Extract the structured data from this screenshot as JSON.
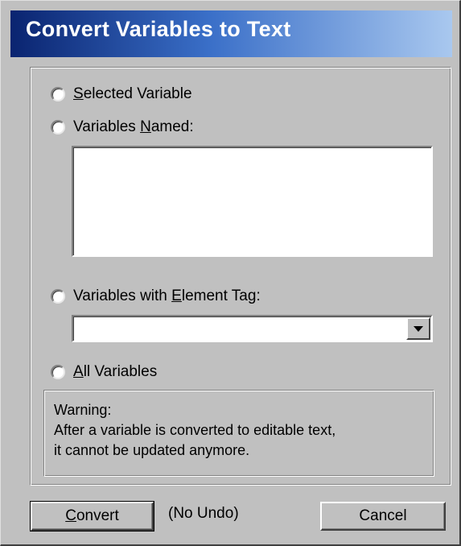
{
  "dialog": {
    "title": "Convert Variables to Text"
  },
  "options": {
    "selected_variable": {
      "pre": "",
      "mnemonic": "S",
      "post": "elected Variable",
      "checked": false
    },
    "variables_named": {
      "pre": "Variables ",
      "mnemonic": "N",
      "post": "amed:",
      "checked": false
    },
    "variables_named_value": "",
    "variables_with_tag": {
      "pre": "Variables with ",
      "mnemonic": "E",
      "post": "lement Tag:",
      "checked": false
    },
    "tag_select_value": "",
    "all_variables": {
      "pre": "",
      "mnemonic": "A",
      "post": "ll Variables",
      "checked": false
    }
  },
  "warning": {
    "line1": "Warning:",
    "line2": "After a variable is converted to editable text,",
    "line3": "it cannot be updated anymore."
  },
  "buttons": {
    "convert": {
      "mnemonic": "C",
      "post": "onvert"
    },
    "no_undo": "(No Undo)",
    "cancel": "Cancel"
  },
  "icons": {
    "dropdown": "chevron-down-icon",
    "radio": "radio-button-icon"
  },
  "colors": {
    "title_start": "#0a2470",
    "title_end": "#a9c8ef",
    "face": "#c0c0c0"
  }
}
